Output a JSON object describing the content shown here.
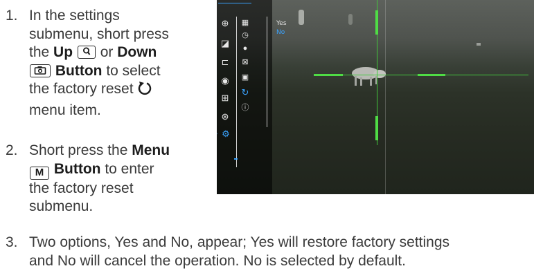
{
  "steps": [
    {
      "number": "1.",
      "lines": {
        "l1": "In the settings",
        "l2a": "submenu, short press",
        "l3a": "the ",
        "l3b": "Up",
        "l3c": " or ",
        "l3d": "Down",
        "l4b": "Button",
        "l4c": " to select",
        "l5": "the factory reset",
        "l6": "menu item."
      },
      "keys": {
        "up": "search-icon",
        "down": "camera-icon"
      },
      "inline_icon": "reset-icon"
    },
    {
      "number": "2.",
      "lines": {
        "l1a": "Short press the ",
        "l1b": "Menu",
        "l2_key": "M",
        "l2b": "Button",
        "l2c": " to enter",
        "l3": "the factory reset",
        "l4": "submenu."
      }
    },
    {
      "number": "3.",
      "lines": {
        "l1": "Two options, Yes and No, appear; Yes will restore factory settings",
        "l2": "and No will cancel the operation. No is selected by default."
      }
    }
  ],
  "screen": {
    "main_menu_icons": [
      "crosshair-icon",
      "display-icon",
      "scale-icon",
      "target-icon",
      "plus-box-icon",
      "compass-icon",
      "gear-icon"
    ],
    "selected_main_icon": "gear-icon",
    "submenu_icons": [
      "calendar-icon",
      "clock-icon",
      "globe-icon",
      "frame-icon",
      "image-icon",
      "reset-icon",
      "info-icon"
    ],
    "selected_submenu_icon": "reset-icon",
    "options": [
      "Yes",
      "No"
    ],
    "selected_option": "No",
    "reticle_color": "#43c83c",
    "highlight_color": "#3aa3ff"
  }
}
